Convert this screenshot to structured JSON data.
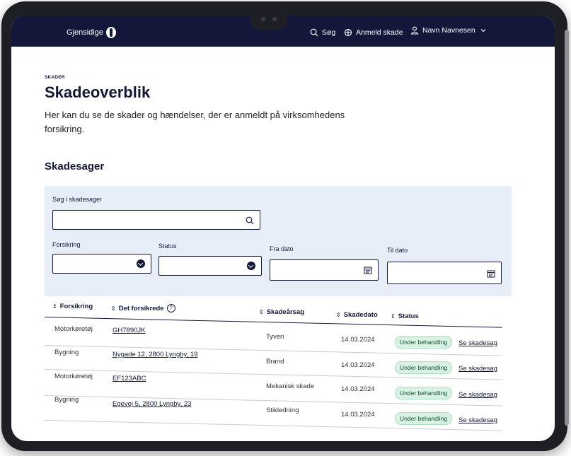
{
  "brand": {
    "name": "Gjensidige"
  },
  "nav": {
    "search_label": "Søg",
    "report_label": "Anmeld skade",
    "user_label": "Navn Navnesen"
  },
  "page": {
    "eyebrow": "SKADER",
    "title": "Skadeoverblik",
    "intro": "Her kan du se de skader og hændelser, der er anmeldt på virksomhedens forsikring.",
    "section_title": "Skadesager"
  },
  "filters": {
    "search_label": "Søg i skadesager",
    "search_value": "",
    "forsikring_label": "Forsikring",
    "forsikring_value": "",
    "status_label": "Status",
    "status_value": "",
    "fra_label": "Fra dato",
    "fra_value": "",
    "til_label": "Til dato",
    "til_value": ""
  },
  "table": {
    "headers": [
      "Forsikring",
      "Det forsikrede",
      "Skadeårsag",
      "Skadedato",
      "Status"
    ],
    "rows": [
      {
        "forsikring": "Motorkøretøj",
        "forsikrede": "GH7890JK",
        "aarsag": "Tyveri",
        "dato": "14.03.2024",
        "status": "Under behandling",
        "action": "Se skadesag"
      },
      {
        "forsikring": "Bygning",
        "forsikrede": "Nygade 12, 2800 Lyngby, 19",
        "aarsag": "Brand",
        "dato": "14.03.2024",
        "status": "Under behandling",
        "action": "Se skadesag"
      },
      {
        "forsikring": "Motorkøretøj",
        "forsikrede": "EF123ABC",
        "aarsag": "Mekanisk skade",
        "dato": "14.03.2024",
        "status": "Under behandling",
        "action": "Se skadesag"
      },
      {
        "forsikring": "Bygning",
        "forsikrede": "Egevej 5, 2800 Lyngby, 23",
        "aarsag": "Stikledning",
        "dato": "14.03.2024",
        "status": "Under behandling",
        "action": "Se skadesag"
      }
    ]
  },
  "colors": {
    "navy": "#13183b",
    "filter_bg": "#e8eef8",
    "badge_bg": "#d8f3e3",
    "badge_text": "#0f5132"
  },
  "icons": [
    "search-icon",
    "report-icon",
    "user-icon",
    "chevron-down-icon",
    "calendar-icon",
    "sort-icon",
    "help-icon"
  ]
}
